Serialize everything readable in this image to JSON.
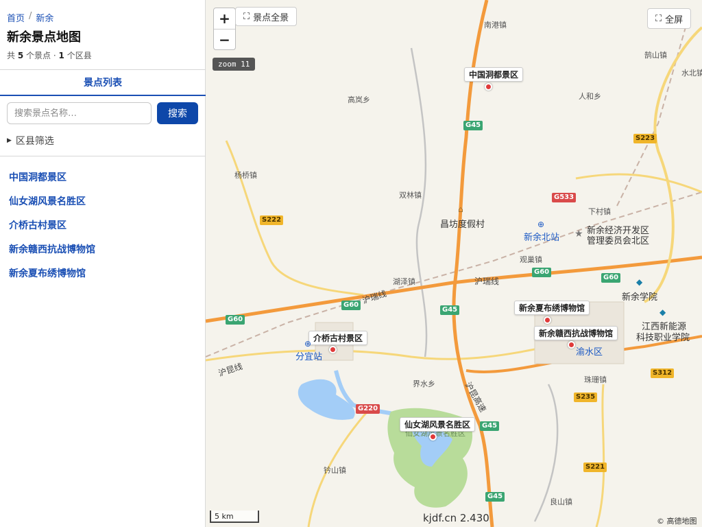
{
  "sidebar": {
    "breadcrumb": {
      "home": "首页",
      "separator": "/",
      "current": "新余"
    },
    "title": "新余景点地图",
    "summary": {
      "prefix": "共",
      "spot_count": "5",
      "spot_unit": "个景点 ·",
      "county_count": "1",
      "county_unit": "个区县"
    },
    "tab_label": "景点列表",
    "search": {
      "placeholder": "搜索景点名称…",
      "button_label": "搜索"
    },
    "filter_label": "区县筛选",
    "spots": [
      "中国洞都景区",
      "仙女湖风景名胜区",
      "介桥古村景区",
      "新余赣西抗战博物馆",
      "新余夏布绣博物馆"
    ]
  },
  "map": {
    "overview_label": "景点全景",
    "fullscreen_label": "全屏",
    "zoom_in": "+",
    "zoom_out": "−",
    "zoom_badge": "zoom 11",
    "scale_label": "5 km",
    "watermark": "kjdf.cn 2.430",
    "attribution": "© 高德地图",
    "poi_labels": [
      "中国洞都景区",
      "新余夏布绣博物馆",
      "新余赣西抗战博物馆",
      "介桥古村景区",
      "仙女湖风景名胜区"
    ],
    "place_labels": [
      "南港镇",
      "高岚乡",
      "人和乡",
      "鹄山镇",
      "水北镇",
      "杨桥镇",
      "双林镇",
      "昌坊度假村",
      "新余北站",
      "下村镇",
      "新余经济开发区",
      "管理委员会北区",
      "观巢镇",
      "湖泽镇",
      "新余学院",
      "江西新能源",
      "科技职业学院",
      "分宜站",
      "渝水区",
      "界水乡",
      "珠珊镇",
      "钤山镇",
      "良山镇",
      "仙女湖风景名胜区"
    ],
    "road_names": [
      "沪瑞线",
      "沪瑞线",
      "沪昆线",
      "沪昆高速"
    ],
    "shields": [
      "G45",
      "S223",
      "G533",
      "S222",
      "G60",
      "G60",
      "G60",
      "G60",
      "G45",
      "G220",
      "G45",
      "S235",
      "S312",
      "S221",
      "G45"
    ]
  },
  "colors": {
    "accent": "#1a4fb4",
    "button": "#0d47a9",
    "pin": "#e03a3a",
    "highway": "#f39a3c",
    "water": "#a3cdf7",
    "park": "#b8dc9a"
  }
}
